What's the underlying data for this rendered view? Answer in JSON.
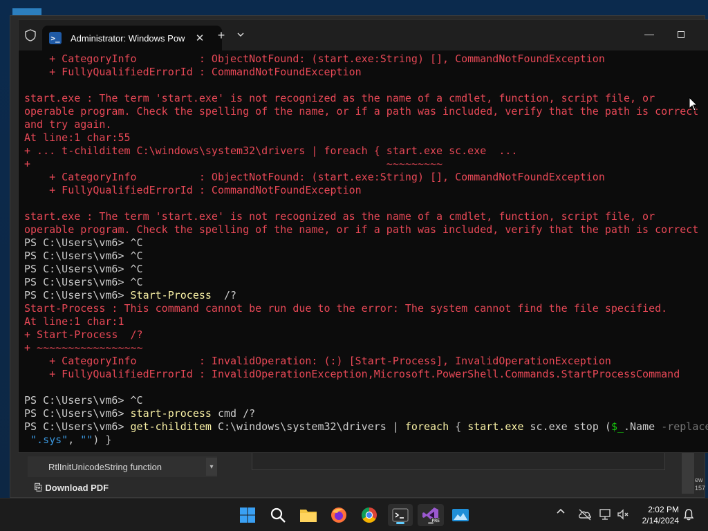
{
  "background_app": {
    "sidebar_item": "RtlInitUnicodeString function",
    "download_label": "Download PDF",
    "edge_text": "ew\n157"
  },
  "terminal": {
    "tab_title": "Administrator: Windows PowerShell",
    "new_tab_symbol": "+",
    "close_symbol": "✕",
    "minimize_symbol": "—",
    "lines": [
      [
        {
          "t": "    + CategoryInfo          : ObjectNotFound: (start.exe:String) [], CommandNotFoundException",
          "c": "err"
        }
      ],
      [
        {
          "t": "    + FullyQualifiedErrorId : CommandNotFoundException",
          "c": "err"
        }
      ],
      [
        {
          "t": "",
          "c": "norm"
        }
      ],
      [
        {
          "t": "start.exe : The term 'start.exe' is not recognized as the name of a cmdlet, function, script file, or",
          "c": "err"
        }
      ],
      [
        {
          "t": "operable program. Check the spelling of the name, or if a path was included, verify that the path is correct",
          "c": "err"
        }
      ],
      [
        {
          "t": "and try again.",
          "c": "err"
        }
      ],
      [
        {
          "t": "At line:1 char:55",
          "c": "err"
        }
      ],
      [
        {
          "t": "+ ... t-childitem C:\\windows\\system32\\drivers | foreach { start.exe sc.exe  ...",
          "c": "err"
        }
      ],
      [
        {
          "t": "+                                                         ~~~~~~~~~",
          "c": "err"
        }
      ],
      [
        {
          "t": "    + CategoryInfo          : ObjectNotFound: (start.exe:String) [], CommandNotFoundException",
          "c": "err"
        }
      ],
      [
        {
          "t": "    + FullyQualifiedErrorId : CommandNotFoundException",
          "c": "err"
        }
      ],
      [
        {
          "t": "",
          "c": "norm"
        }
      ],
      [
        {
          "t": "start.exe : The term 'start.exe' is not recognized as the name of a cmdlet, function, script file, or",
          "c": "err"
        }
      ],
      [
        {
          "t": "operable program. Check the spelling of the name, or if a path was included, verify that the path is correct",
          "c": "err"
        }
      ],
      [
        {
          "t": "PS C:\\Users\\vm6> ^C",
          "c": "norm"
        }
      ],
      [
        {
          "t": "PS C:\\Users\\vm6> ^C",
          "c": "norm"
        }
      ],
      [
        {
          "t": "PS C:\\Users\\vm6> ^C",
          "c": "norm"
        }
      ],
      [
        {
          "t": "PS C:\\Users\\vm6> ^C",
          "c": "norm"
        }
      ],
      [
        {
          "t": "PS C:\\Users\\vm6> ",
          "c": "norm"
        },
        {
          "t": "Start-Process",
          "c": "cmd"
        },
        {
          "t": "  /?",
          "c": "norm"
        }
      ],
      [
        {
          "t": "Start-Process : This command cannot be run due to the error: The system cannot find the file specified.",
          "c": "err"
        }
      ],
      [
        {
          "t": "At line:1 char:1",
          "c": "err"
        }
      ],
      [
        {
          "t": "+ Start-Process  /?",
          "c": "err"
        }
      ],
      [
        {
          "t": "+ ~~~~~~~~~~~~~~~~~",
          "c": "err"
        }
      ],
      [
        {
          "t": "    + CategoryInfo          : InvalidOperation: (:) [Start-Process], InvalidOperationException",
          "c": "err"
        }
      ],
      [
        {
          "t": "    + FullyQualifiedErrorId : InvalidOperationException,Microsoft.PowerShell.Commands.StartProcessCommand",
          "c": "err"
        }
      ],
      [
        {
          "t": "",
          "c": "norm"
        }
      ],
      [
        {
          "t": "PS C:\\Users\\vm6> ^C",
          "c": "norm"
        }
      ],
      [
        {
          "t": "PS C:\\Users\\vm6> ",
          "c": "norm"
        },
        {
          "t": "start-process",
          "c": "cmd"
        },
        {
          "t": " cmd /?",
          "c": "norm"
        }
      ],
      [
        {
          "t": "PS C:\\Users\\vm6> ",
          "c": "norm"
        },
        {
          "t": "get-childitem",
          "c": "cmd"
        },
        {
          "t": " C:\\windows\\system32\\drivers | ",
          "c": "norm"
        },
        {
          "t": "foreach",
          "c": "cmd"
        },
        {
          "t": " { ",
          "c": "norm"
        },
        {
          "t": "start.exe",
          "c": "cmd"
        },
        {
          "t": " sc.exe stop (",
          "c": "norm"
        },
        {
          "t": "$_",
          "c": "var"
        },
        {
          "t": ".Name ",
          "c": "norm"
        },
        {
          "t": "-replace",
          "c": "param"
        }
      ],
      [
        {
          "t": " \".sys\"",
          "c": "str"
        },
        {
          "t": ", ",
          "c": "norm"
        },
        {
          "t": "\"\"",
          "c": "str"
        },
        {
          "t": ") }",
          "c": "norm"
        }
      ]
    ]
  },
  "taskbar": {
    "time": "2:02 PM",
    "date": "2/14/2024",
    "tray_chevron": "^",
    "apps": [
      "windows-start-icon",
      "search-icon",
      "file-explorer-icon",
      "firefox-icon",
      "chrome-icon",
      "terminal-icon",
      "visual-studio-icon",
      "photos-icon"
    ]
  },
  "colors": {
    "error": "#e74856",
    "normal": "#cccccc",
    "command": "#f9f1a5",
    "variable": "#16c60c",
    "parameter": "#767676",
    "string": "#3a96dd",
    "terminal_bg": "#0c0c0c",
    "taskbar_bg": "#1c1c1c"
  }
}
